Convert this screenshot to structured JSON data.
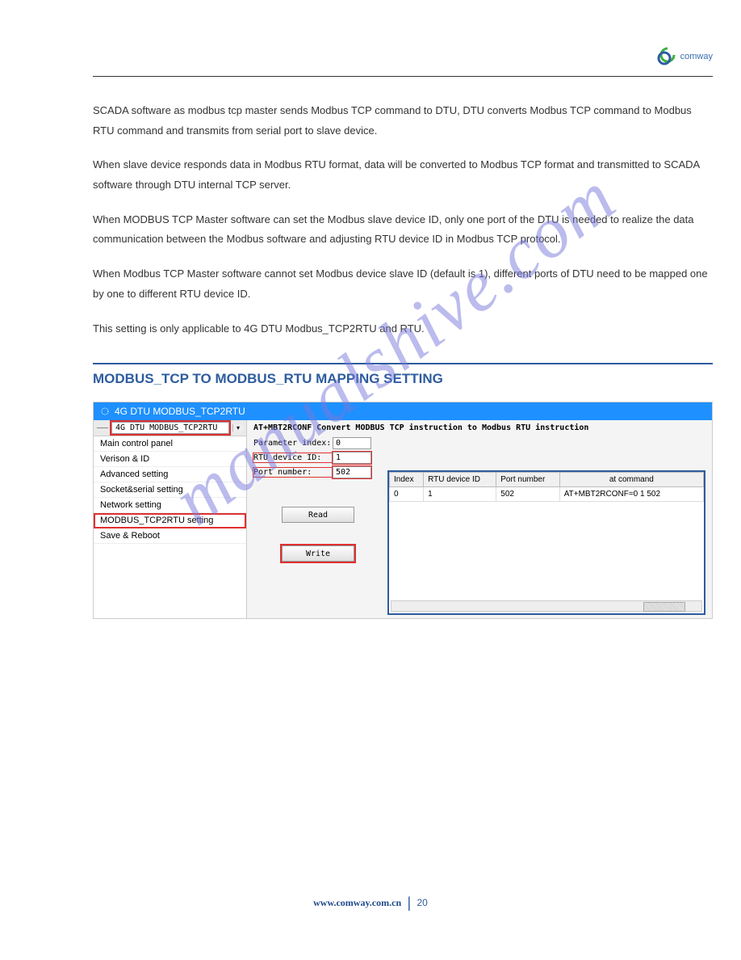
{
  "header": {
    "logo_text": "comway"
  },
  "doc": {
    "p1": "SCADA software as modbus tcp master sends Modbus TCP command to DTU, DTU converts Modbus TCP command to Modbus RTU command and transmits from serial port to slave device.",
    "p2": "When slave device responds data in Modbus RTU format, data will be converted to Modbus TCP format and transmitted to SCADA software through DTU internal TCP server.",
    "p3": "When MODBUS TCP Master software can set the Modbus slave device ID, only one port of the DTU is needed to realize the data communication between the Modbus software and adjusting RTU device ID in Modbus TCP protocol.",
    "p4": "When Modbus TCP Master software cannot set Modbus device slave ID (default is 1), different ports of DTU need to be mapped one by one to different RTU device ID.",
    "p5": "This setting is only applicable to 4G DTU Modbus_TCP2RTU and RTU."
  },
  "section_title": "MODBUS_TCP TO MODBUS_RTU MAPPING SETTING",
  "app": {
    "window_title": "4G DTU MODBUS_TCP2RTU",
    "dropdown": "4G DTU MODBUS_TCP2RTU",
    "sidebar": {
      "items": [
        {
          "label": "Main control panel"
        },
        {
          "label": "Verison & ID"
        },
        {
          "label": "Advanced setting"
        },
        {
          "label": "Socket&serial setting"
        },
        {
          "label": "Network setting"
        },
        {
          "label": "MODBUS_TCP2RTU setting"
        },
        {
          "label": "Save & Reboot"
        }
      ]
    },
    "panel_title": "AT+MBT2RCONF Convert MODBUS TCP instruction to Modbus RTU instruction",
    "form": {
      "param_index_label": "Parameter index:",
      "param_index_value": "0",
      "rtu_id_label": "RTU device ID:",
      "rtu_id_value": "1",
      "port_label": "Port number:",
      "port_value": "502"
    },
    "buttons": {
      "read": "Read",
      "write": "Write"
    },
    "table": {
      "headers": {
        "c0": "Index",
        "c1": "RTU device ID",
        "c2": "Port number",
        "c3": "at command"
      },
      "row0": {
        "c0": "0",
        "c1": "1",
        "c2": "502",
        "c3": "AT+MBT2RCONF=0 1 502"
      }
    }
  },
  "footer": {
    "link": "www.comway.com.cn",
    "page": "20"
  },
  "watermark": "manualshive.com"
}
